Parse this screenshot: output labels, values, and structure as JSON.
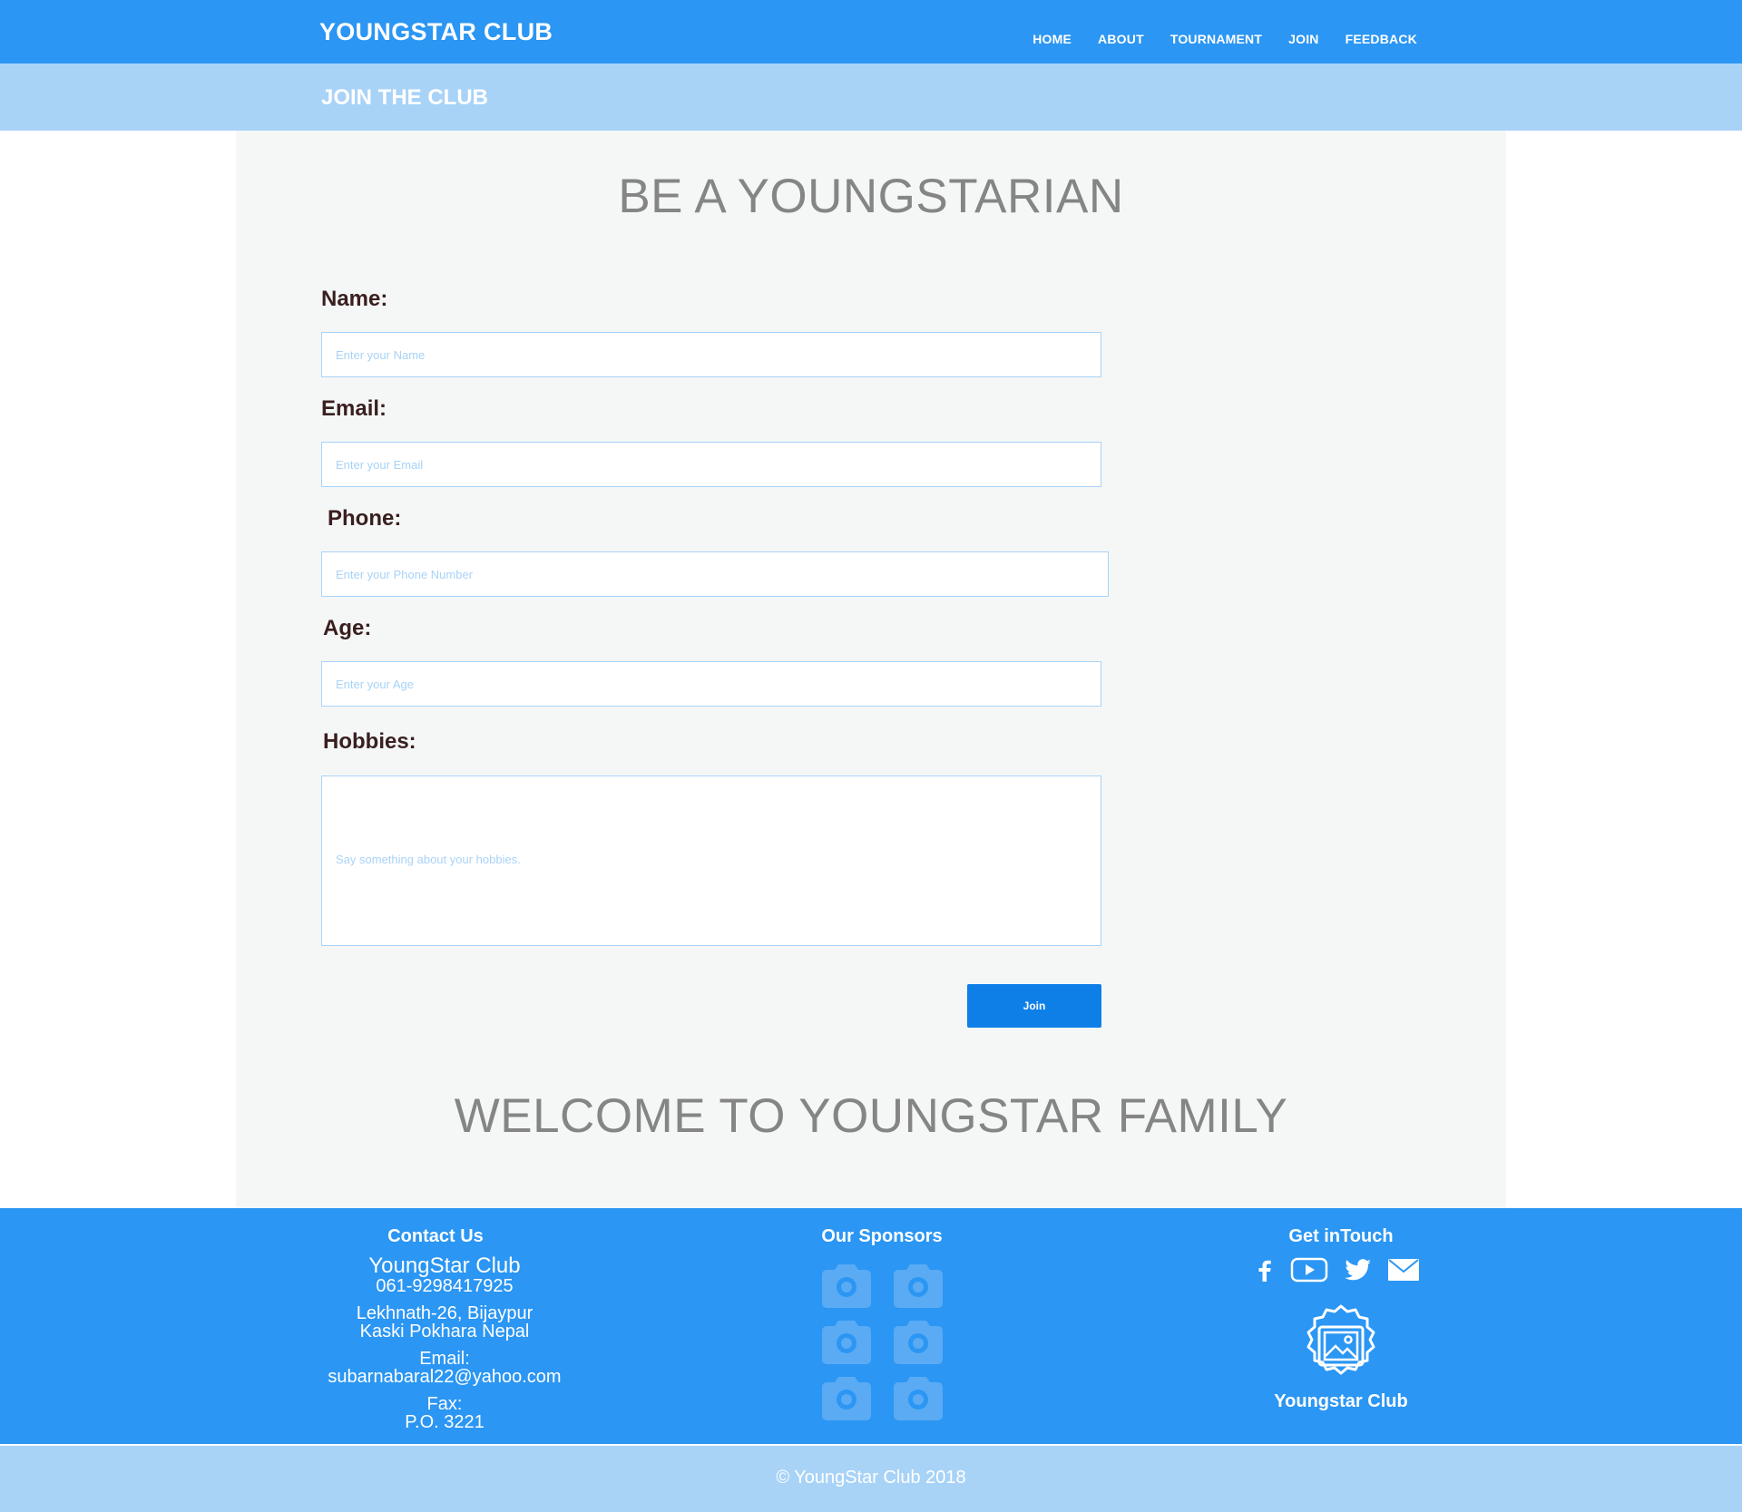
{
  "header": {
    "brand": "YOUNGSTAR CLUB",
    "nav": [
      "HOME",
      "ABOUT",
      "TOURNAMENT",
      "JOIN",
      "FEEDBACK"
    ]
  },
  "subheader": {
    "title": "JOIN THE CLUB"
  },
  "main": {
    "heading": "BE A YOUNGSTARIAN",
    "welcome": "WELCOME TO YOUNGSTAR FAMILY"
  },
  "form": {
    "name_label": "Name:",
    "name_placeholder": "Enter your Name",
    "email_label": "Email:",
    "email_placeholder": "Enter your Email",
    "phone_label": "Phone:",
    "phone_placeholder": "Enter your Phone Number",
    "age_label": "Age:",
    "age_placeholder": "Enter your Age",
    "hobbies_label": "Hobbies:",
    "hobbies_placeholder": "Say something about your hobbies.",
    "submit_label": "Join"
  },
  "footer": {
    "contact_title": "Contact Us",
    "club_name": "YoungStar Club",
    "phone": "061-9298417925",
    "address_line1": "Lekhnath-26, Bijaypur",
    "address_line2": "Kaski Pokhara Nepal",
    "email_label": "Email:",
    "email": "subarnabaral22@yahoo.com",
    "fax_label": "Fax:",
    "fax": "P.O. 3221",
    "sponsors_title": "Our Sponsors",
    "sponsor_icons": [
      "camera-icon",
      "camera-icon",
      "camera-icon",
      "camera-icon",
      "camera-icon",
      "camera-icon"
    ],
    "get_in_touch_title": "Get inTouch",
    "social_icons": [
      "facebook-icon",
      "youtube-icon",
      "twitter-icon",
      "mail-icon"
    ],
    "badge_label": "Youngstar Club",
    "copyright": "© YoungStar Club 2018"
  },
  "colors": {
    "primary": "#2b96f3",
    "light": "#a8d3f7",
    "button": "#0f7fe8",
    "label_text": "#3a1f1f",
    "heading_text": "#858585",
    "panel_bg": "#f5f7f7"
  }
}
